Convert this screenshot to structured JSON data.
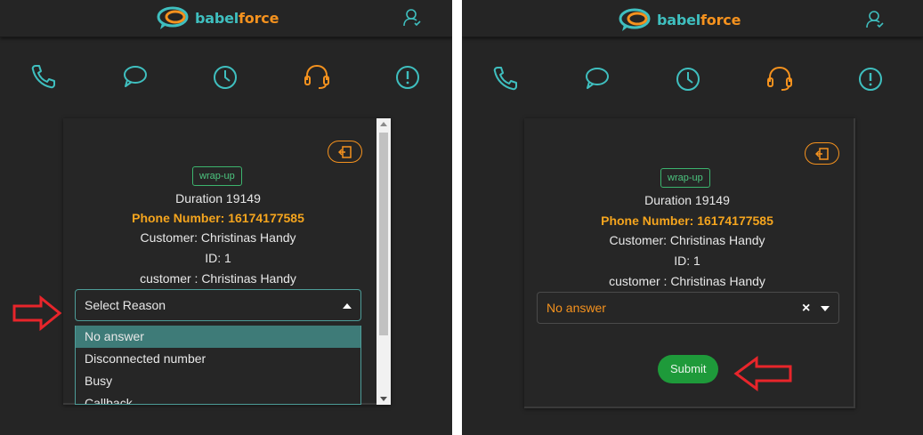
{
  "colors": {
    "teal": "#3fbfbf",
    "orange": "#f5921e",
    "green": "#1e9a3a",
    "background": "#252525",
    "annotation": "#e8252b"
  },
  "logo": {
    "part1": "babel",
    "part2": "force"
  },
  "icons": {
    "user": "user-icon",
    "nav": [
      "phone-icon",
      "chat-icon",
      "clock-icon",
      "headset-icon",
      "alert-icon"
    ],
    "exit": "exit-icon"
  },
  "panels": [
    {
      "badge": "wrap-up",
      "duration": "Duration 19149",
      "phone": "Phone Number: 16174177585",
      "customer": "Customer: Christinas Handy",
      "id": "ID: 1",
      "customer_field": "customer : Christinas Handy",
      "select": {
        "placeholder": "Select Reason"
      },
      "options": [
        "No answer",
        "Disconnected number",
        "Busy",
        "Callback"
      ]
    },
    {
      "badge": "wrap-up",
      "duration": "Duration 19149",
      "phone": "Phone Number: 16174177585",
      "customer": "Customer: Christinas Handy",
      "id": "ID: 1",
      "customer_field": "customer : Christinas Handy",
      "select": {
        "value": "No answer",
        "clear": "×"
      },
      "submit_label": "Submit"
    }
  ]
}
